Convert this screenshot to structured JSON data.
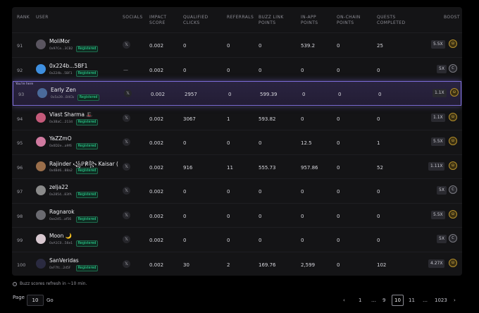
{
  "headers": {
    "rank": "RANK",
    "user": "USER",
    "socials": "SOCIALS",
    "impact": "IMPACT\nSCORE",
    "qualified": "QUALIFIED\nCLICKS",
    "referrals": "REFERRALS",
    "buzz": "BUZZ LINK\nPOINTS",
    "inapp": "IN-APP\nPOINTS",
    "onchain": "ON-CHAIN\nPOINTS",
    "quests": "QUESTS\nCOMPLETED",
    "boost": "BOOST"
  },
  "you_here_label": "You're here",
  "registered_label": "Registered",
  "rows": [
    {
      "rank": "91",
      "name": "MoliMor",
      "addr": "0x97Ce...3CB2",
      "social": "x",
      "impact": "0.002",
      "qualified": "0",
      "referrals": "0",
      "buzz": "0",
      "inapp": "539.2",
      "onchain": "0",
      "quests": "25",
      "boost": "5.5X",
      "coin": "gold",
      "registered": true,
      "avatar": "#5a5560"
    },
    {
      "rank": "92",
      "name": "0x224b...5BF1",
      "addr": "0x224b...5BF1",
      "social": "dash",
      "impact": "0.002",
      "qualified": "0",
      "referrals": "0",
      "buzz": "0",
      "inapp": "0",
      "onchain": "0",
      "quests": "0",
      "boost": "5X",
      "coin": "plain",
      "registered": true,
      "avatar": "#3e8fe0"
    },
    {
      "rank": "93",
      "name": "Early Zen",
      "addr": "0x5a39...B4Cb",
      "social": "x",
      "impact": "0.002",
      "qualified": "2957",
      "referrals": "0",
      "buzz": "599.39",
      "inapp": "0",
      "onchain": "0",
      "quests": "0",
      "boost": "1.1X",
      "coin": "gold",
      "registered": true,
      "avatar": "#4a6a9a",
      "me": true
    },
    {
      "rank": "94",
      "name": "Vlast Sharma 🎩",
      "addr": "0x3BaC...2134",
      "social": "x",
      "impact": "0.002",
      "qualified": "3067",
      "referrals": "1",
      "buzz": "593.82",
      "inapp": "0",
      "onchain": "0",
      "quests": "0",
      "boost": "1.1X",
      "coin": "gold",
      "registered": true,
      "avatar": "#c45a7a"
    },
    {
      "rank": "95",
      "name": "YaZZmO",
      "addr": "0x0D2e...a9f6",
      "social": "x",
      "impact": "0.002",
      "qualified": "0",
      "referrals": "0",
      "buzz": "0",
      "inapp": "12.5",
      "onchain": "0",
      "quests": "1",
      "boost": "5.5X",
      "coin": "gold",
      "registered": true,
      "avatar": "#d07aa0"
    },
    {
      "rank": "96",
      "name": "Rajinder ꧁ℙ℟꧂ Kaisar (",
      "addr": "0x4Bd6...88a2",
      "social": "x",
      "impact": "0.002",
      "qualified": "916",
      "referrals": "11",
      "buzz": "555.73",
      "inapp": "957.86",
      "onchain": "0",
      "quests": "52",
      "boost": "1.11X",
      "coin": "gold",
      "registered": true,
      "avatar": "#9a6e4a"
    },
    {
      "rank": "97",
      "name": "zelja22",
      "addr": "0x2854...83fA",
      "social": "x",
      "impact": "0.002",
      "qualified": "0",
      "referrals": "0",
      "buzz": "0",
      "inapp": "0",
      "onchain": "0",
      "quests": "0",
      "boost": "5X",
      "coin": "plain",
      "registered": true,
      "avatar": "#8a8a8a"
    },
    {
      "rank": "98",
      "name": "Ragnarok",
      "addr": "0xe245...af56",
      "social": "x",
      "impact": "0.002",
      "qualified": "0",
      "referrals": "0",
      "buzz": "0",
      "inapp": "0",
      "onchain": "0",
      "quests": "0",
      "boost": "5.5X",
      "coin": "gold",
      "registered": true,
      "avatar": "#6a6a70"
    },
    {
      "rank": "99",
      "name": "Moon 🌙",
      "addr": "0xA1C0...56e1",
      "social": "x",
      "impact": "0.002",
      "qualified": "0",
      "referrals": "0",
      "buzz": "0",
      "inapp": "0",
      "onchain": "0",
      "quests": "0",
      "boost": "5X",
      "coin": "plain",
      "registered": true,
      "avatar": "#d8c8d0"
    },
    {
      "rank": "100",
      "name": "SanVeridas",
      "addr": "0xF7fc...2d5F",
      "social": "x",
      "impact": "0.002",
      "qualified": "30",
      "referrals": "2",
      "buzz": "169.76",
      "inapp": "2,599",
      "onchain": "0",
      "quests": "102",
      "boost": "4.27X",
      "coin": "gold",
      "registered": true,
      "avatar": "#2a2a40"
    }
  ],
  "footnote": "Buzz scores refresh in ~10 min.",
  "pager": {
    "page_label": "Page",
    "page_value": "10",
    "go_label": "Go",
    "prev": "‹",
    "next": "›",
    "pages": [
      "1",
      "…",
      "9",
      "10",
      "11",
      "…",
      "1023"
    ],
    "active": "10"
  }
}
